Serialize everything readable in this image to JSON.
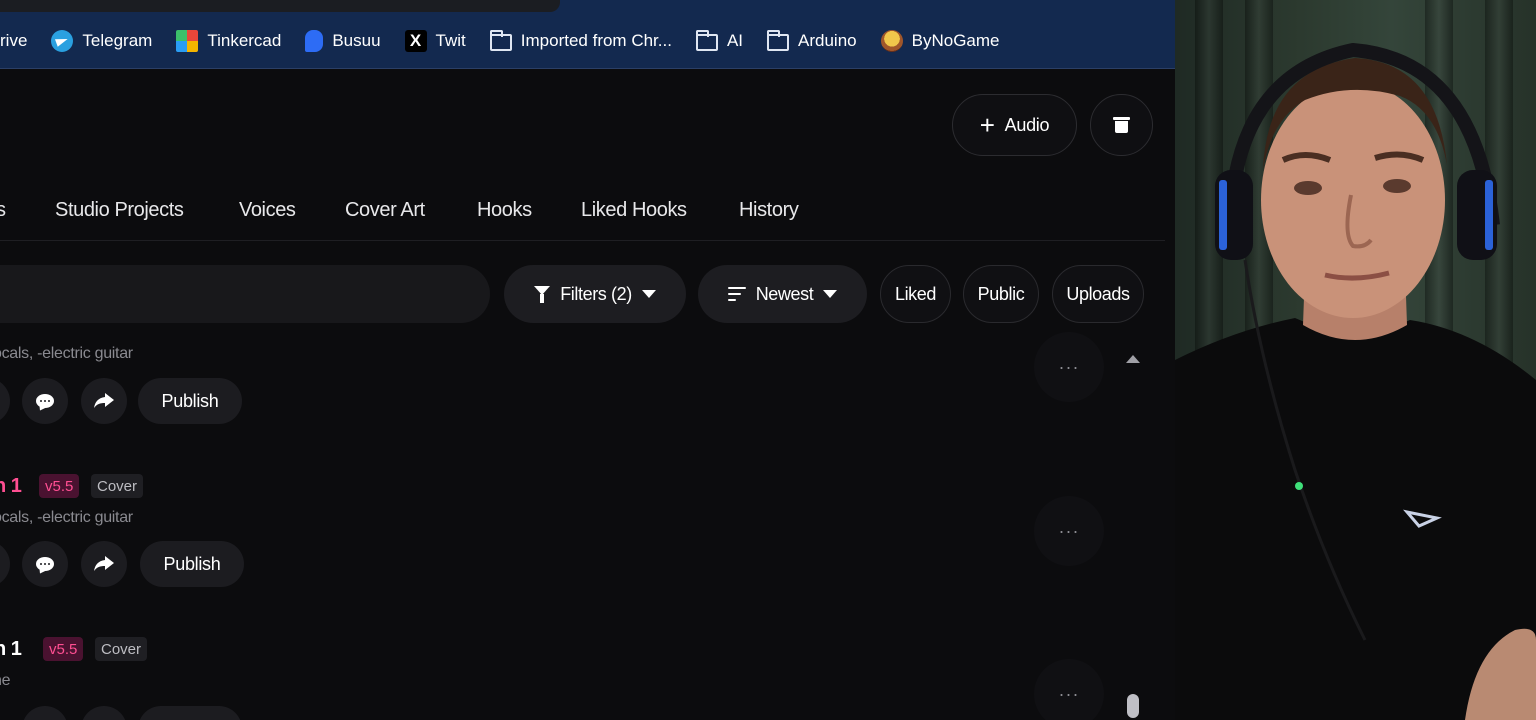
{
  "bookmarks": {
    "first_fragment": "rive",
    "items": [
      {
        "label": "Telegram",
        "icon": "telegram-icon"
      },
      {
        "label": "Tinkercad",
        "icon": "tinkercad-icon"
      },
      {
        "label": "Busuu",
        "icon": "busuu-icon"
      },
      {
        "label": "Twit",
        "icon": "x-icon"
      },
      {
        "label": "Imported from Chr...",
        "icon": "folder-icon"
      },
      {
        "label": "AI",
        "icon": "folder-icon"
      },
      {
        "label": "Arduino",
        "icon": "folder-icon"
      },
      {
        "label": "ByNoGame",
        "icon": "bynogame-icon"
      }
    ]
  },
  "header": {
    "audio_label": "Audio",
    "plus_glyph": "+"
  },
  "tabs": {
    "partial": "s",
    "studio_projects": "Studio Projects",
    "voices": "Voices",
    "cover_art": "Cover Art",
    "hooks": "Hooks",
    "liked_hooks": "Liked Hooks",
    "history": "History"
  },
  "filters": {
    "filters_label": "Filters (2)",
    "sort_label": "Newest",
    "liked": "Liked",
    "public": "Public",
    "uploads": "Uploads"
  },
  "rows": [
    {
      "tags": "ocals, -electric guitar",
      "publish": "Publish",
      "more": "···"
    },
    {
      "title": "n 1",
      "version": "v5.5",
      "type": "Cover",
      "tags": "ocals, -electric guitar",
      "publish": "Publish",
      "more": "···"
    },
    {
      "title": "n 1",
      "version": "v5.5",
      "type": "Cover",
      "tags": "ne",
      "more": "···"
    }
  ],
  "colors": {
    "bookmarks_bg": "#13294f",
    "app_bg": "#0c0c0e",
    "accent_pink": "#ff4f92"
  }
}
